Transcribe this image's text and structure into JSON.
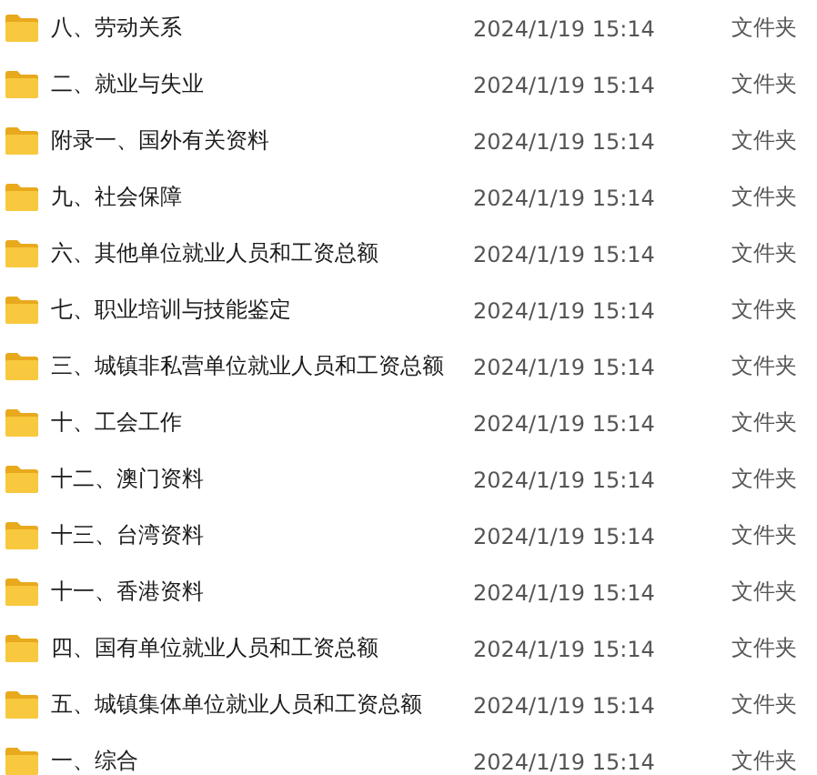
{
  "files": [
    {
      "name": "八、劳动关系",
      "modified": "2024/1/19 15:14",
      "type": "文件夹"
    },
    {
      "name": "二、就业与失业",
      "modified": "2024/1/19 15:14",
      "type": "文件夹"
    },
    {
      "name": "附录一、国外有关资料",
      "modified": "2024/1/19 15:14",
      "type": "文件夹"
    },
    {
      "name": "九、社会保障",
      "modified": "2024/1/19 15:14",
      "type": "文件夹"
    },
    {
      "name": "六、其他单位就业人员和工资总额",
      "modified": "2024/1/19 15:14",
      "type": "文件夹"
    },
    {
      "name": "七、职业培训与技能鉴定",
      "modified": "2024/1/19 15:14",
      "type": "文件夹"
    },
    {
      "name": "三、城镇非私营单位就业人员和工资总额",
      "modified": "2024/1/19 15:14",
      "type": "文件夹"
    },
    {
      "name": "十、工会工作",
      "modified": "2024/1/19 15:14",
      "type": "文件夹"
    },
    {
      "name": "十二、澳门资料",
      "modified": "2024/1/19 15:14",
      "type": "文件夹"
    },
    {
      "name": "十三、台湾资料",
      "modified": "2024/1/19 15:14",
      "type": "文件夹"
    },
    {
      "name": "十一、香港资料",
      "modified": "2024/1/19 15:14",
      "type": "文件夹"
    },
    {
      "name": "四、国有单位就业人员和工资总额",
      "modified": "2024/1/19 15:14",
      "type": "文件夹"
    },
    {
      "name": "五、城镇集体单位就业人员和工资总额",
      "modified": "2024/1/19 15:14",
      "type": "文件夹"
    },
    {
      "name": "一、综合",
      "modified": "2024/1/19 15:14",
      "type": "文件夹"
    }
  ]
}
